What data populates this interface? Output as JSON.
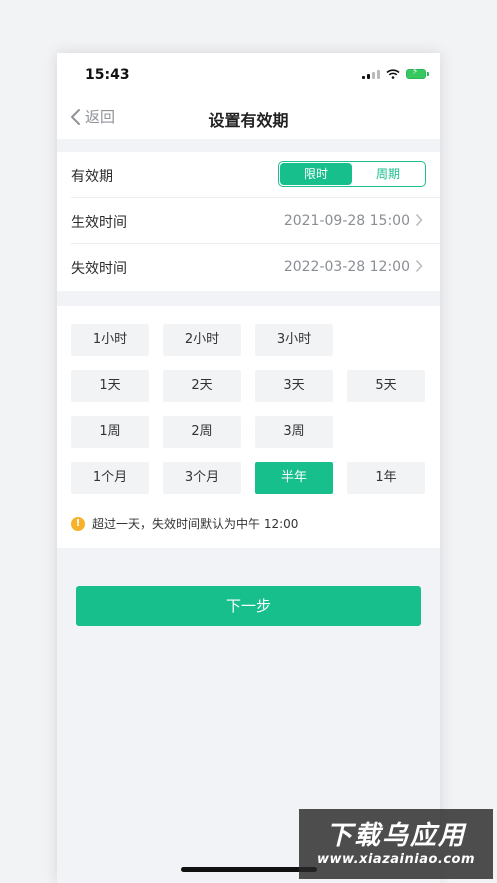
{
  "status": {
    "time": "15:43"
  },
  "nav": {
    "back_label": "返回",
    "title": "设置有效期"
  },
  "form": {
    "validity_label": "有效期",
    "segments": [
      "限时",
      "周期"
    ],
    "selected_segment": 0,
    "start_label": "生效时间",
    "start_value": "2021-09-28 15:00",
    "end_label": "失效时间",
    "end_value": "2022-03-28 12:00"
  },
  "durations": {
    "rows": [
      [
        "1小时",
        "2小时",
        "3小时"
      ],
      [
        "1天",
        "2天",
        "3天",
        "5天"
      ],
      [
        "1周",
        "2周",
        "3周"
      ],
      [
        "1个月",
        "3个月",
        "半年",
        "1年"
      ]
    ],
    "selected": "半年"
  },
  "note": "超过一天，失效时间默认为中午 12:00",
  "next_button": "下一步",
  "watermark": {
    "line1": "下载乌应用",
    "line2": "www.xiazainiao.com"
  },
  "colors": {
    "accent": "#17bf8c",
    "warning": "#f7b12a",
    "background": "#f2f3f6"
  }
}
